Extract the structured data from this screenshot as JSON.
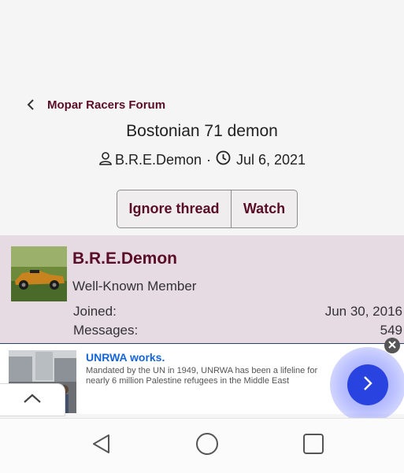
{
  "breadcrumb": {
    "label": "Mopar Racers Forum",
    "icon": "chevron-left-icon"
  },
  "thread": {
    "title": "Bostonian 71 demon",
    "author": "B.R.E.Demon",
    "separator": "·",
    "date": "Jul 6, 2021"
  },
  "actions": {
    "ignore_label": "Ignore thread",
    "watch_label": "Watch"
  },
  "post_author": {
    "username": "B.R.E.Demon",
    "title": "Well-Known Member",
    "joined_label": "Joined:",
    "joined_value": "Jun 30, 2016",
    "messages_label": "Messages:",
    "messages_value": "549"
  },
  "ad": {
    "title": "UNRWA works.",
    "description": "Mandated by the UN in 1949, UNRWA has been a lifeline for nearly 6 million Palestine refugees in the Middle East",
    "close_icon": "close-icon",
    "go_icon": "chevron-right-icon"
  },
  "colors": {
    "accent": "#5a0d26",
    "panel": "#e6dae3",
    "ad_link": "#1565d8",
    "ad_button": "#2843e0"
  },
  "system_nav": {
    "back": "back-icon",
    "home": "home-icon",
    "recents": "recents-icon"
  }
}
